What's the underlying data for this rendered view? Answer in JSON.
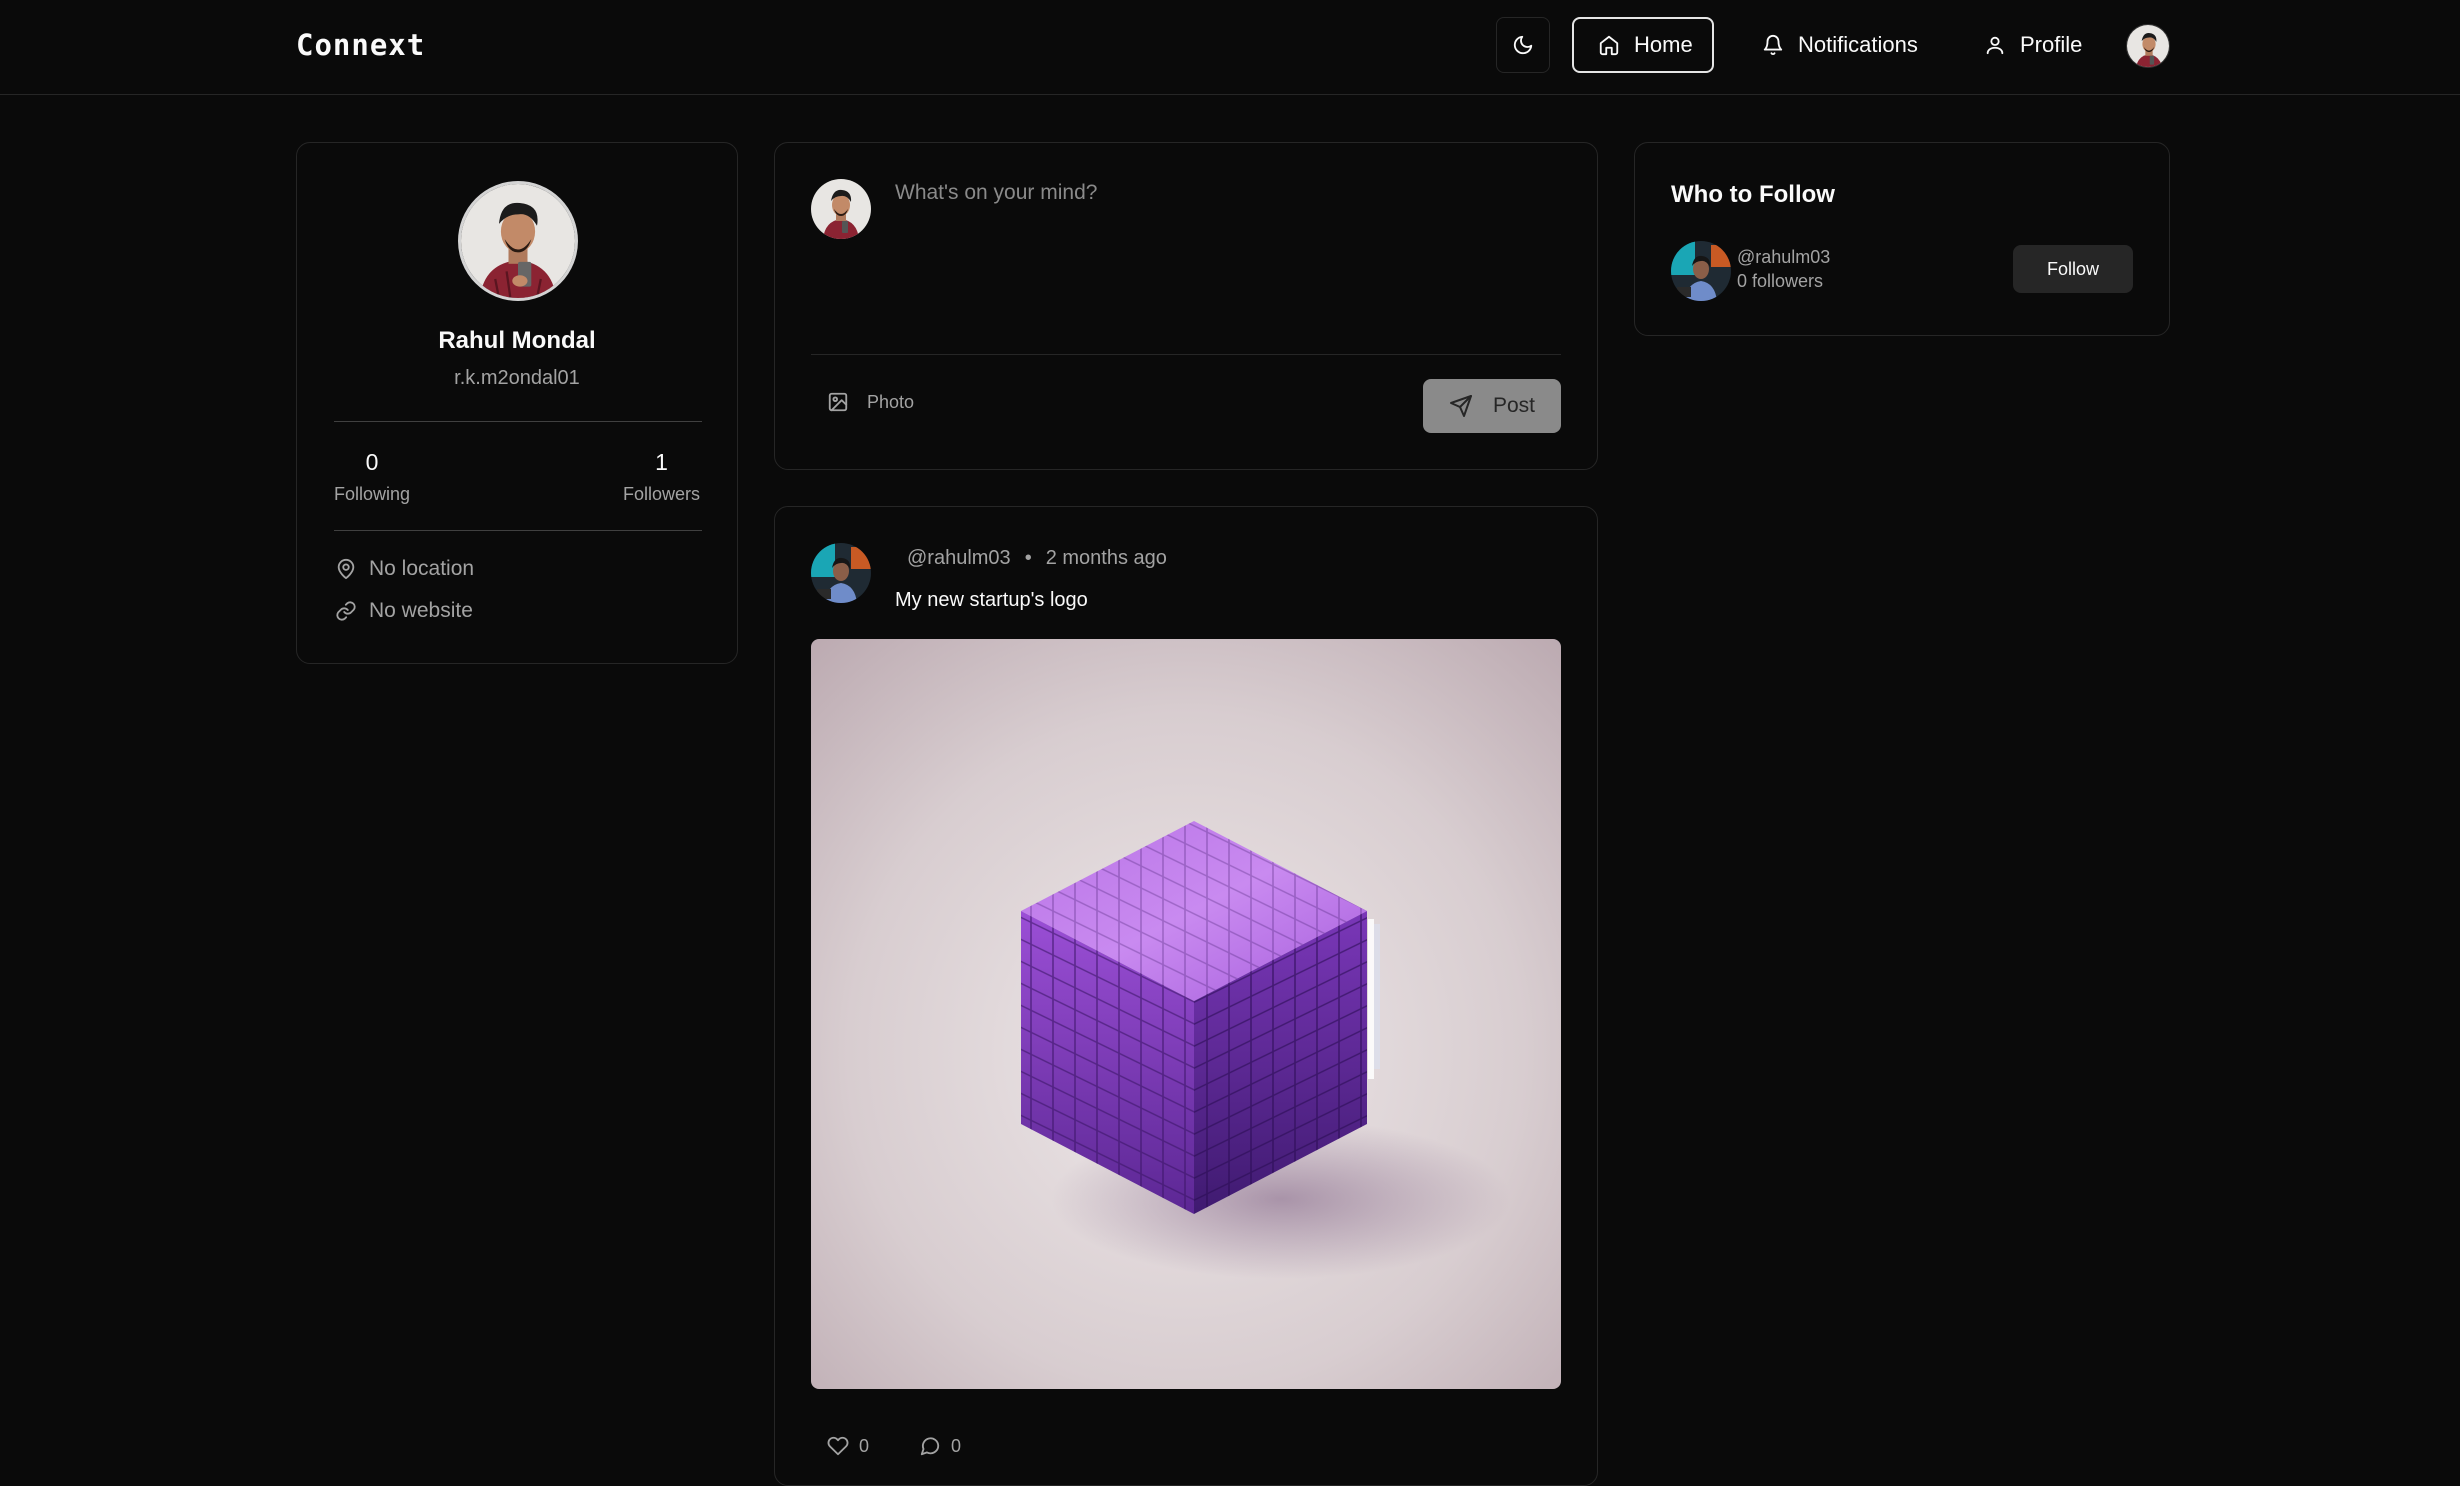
{
  "header": {
    "brand": "Connext",
    "nav": {
      "home": "Home",
      "notifications": "Notifications",
      "profile": "Profile"
    }
  },
  "profile_card": {
    "name": "Rahul Mondal",
    "username": "r.k.m2ondal01",
    "following_count": "0",
    "following_label": "Following",
    "followers_count": "1",
    "followers_label": "Followers",
    "location": "No location",
    "website": "No website"
  },
  "composer": {
    "placeholder": "What's on your mind?",
    "photo_label": "Photo",
    "post_label": "Post"
  },
  "post": {
    "author": "@rahulm03",
    "separator": "•",
    "time": "2 months ago",
    "text": "My new startup's logo",
    "likes": "0",
    "comments": "0"
  },
  "who_to_follow": {
    "title": "Who to Follow",
    "user_handle": "@rahulm03",
    "user_followers": "0 followers",
    "follow_label": "Follow"
  },
  "colors": {
    "background": "#0a0a0a",
    "border": "#262626",
    "text": "#fafafa",
    "muted": "#a3a3a3",
    "accent_purple": "#9b4fd6"
  }
}
